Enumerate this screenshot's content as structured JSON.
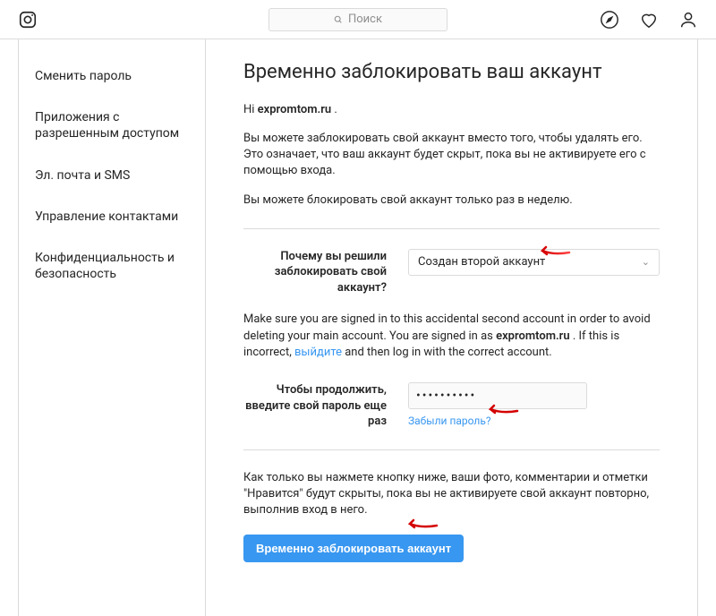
{
  "topbar": {
    "search_placeholder": "Поиск"
  },
  "sidebar": {
    "items": [
      {
        "label": "Сменить пароль"
      },
      {
        "label": "Приложения с разрешенным доступом"
      },
      {
        "label": "Эл. почта и SMS"
      },
      {
        "label": "Управление контактами"
      },
      {
        "label": "Конфиденциальность и безопасность"
      }
    ]
  },
  "content": {
    "title": "Временно заблокировать ваш аккаунт",
    "greeting_prefix": "Hi ",
    "username": "expromtom.ru",
    "greeting_suffix": " .",
    "desc1": "Вы можете заблокировать свой аккаунт вместо того, чтобы удалять его. Это означает, что ваш аккаунт будет скрыт, пока вы не активируете его с помощью входа.",
    "desc2": "Вы можете блокировать свой аккаунт только раз в неделю.",
    "reason_label": "Почему вы решили заблокировать свой аккаунт?",
    "reason_selected": "Создан второй аккаунт",
    "info_text_a": "Make sure you are signed in to this accidental second account in order to avoid deleting your main account. You are signed in as ",
    "info_text_b": " . If this is incorrect, ",
    "logout_link": "выйдите",
    "info_text_c": " and then log in with the correct account.",
    "password_label": "Чтобы продолжить, введите свой пароль еще раз",
    "password_masked": "••••••••••",
    "forgot_link": "Забыли пароль?",
    "final_text": "Как только вы нажмете кнопку ниже, ваши фото, комментарии и отметки \"Нравится\" будут скрыты, пока вы не активируете свой аккаунт повторно, выполнив вход в него.",
    "submit_label": "Временно заблокировать аккаунт"
  },
  "colors": {
    "accent": "#3897f0",
    "border": "#dbdbdb",
    "text": "#262626",
    "muted": "#8e8e8e",
    "arrow": "#d40000"
  }
}
